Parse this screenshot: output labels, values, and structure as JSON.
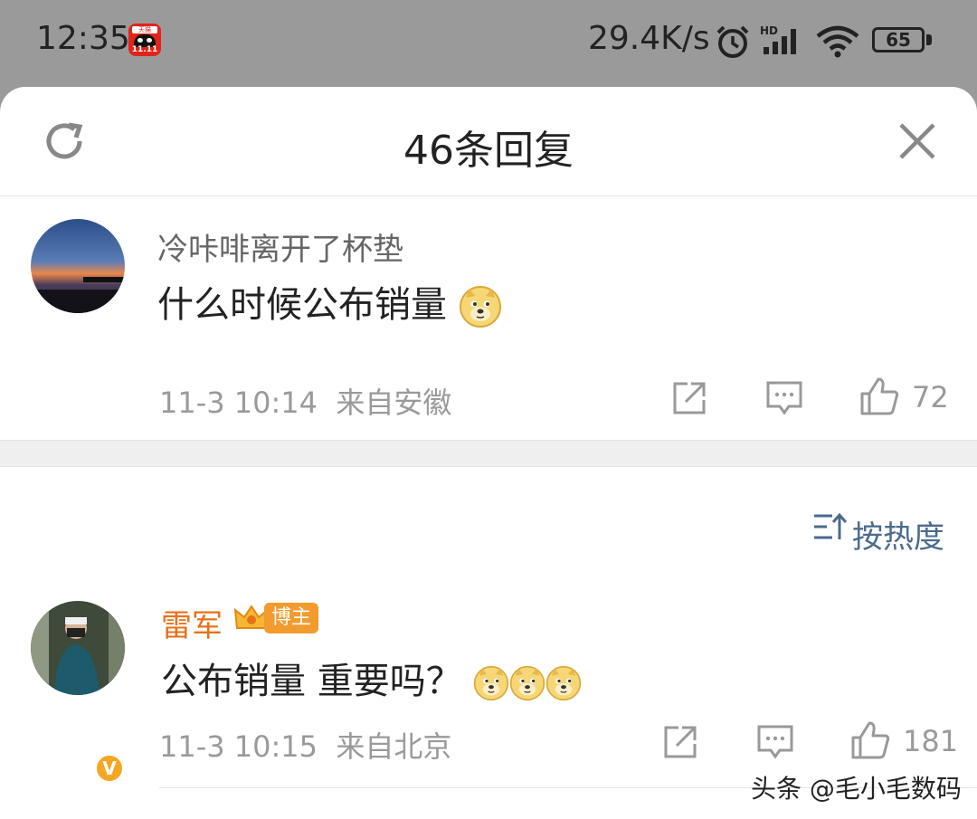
{
  "status_bar": {
    "time": "12:35",
    "network_speed": "29.4K/s",
    "signal_badge": "HD",
    "battery": "65",
    "app_badge_top": "天猫",
    "app_badge_bottom": "11.11"
  },
  "sheet": {
    "title": "46条回复",
    "icons": {
      "refresh": "refresh-icon",
      "close": "close-icon"
    }
  },
  "comments": [
    {
      "username": "冷咔啡离开了杯垫",
      "text": "什么时候公布销量",
      "emoji_count": 1,
      "time": "11-3 10:14",
      "source": "来自安徽",
      "likes": "72"
    },
    {
      "username": "雷军",
      "badge": "博主",
      "verified": "V",
      "text": "公布销量 重要吗？",
      "emoji_count": 3,
      "time": "11-3 10:15",
      "source": "来自北京",
      "likes": "181"
    }
  ],
  "sort": {
    "label": "按热度"
  },
  "watermark": "头条 @毛小毛数码",
  "colors": {
    "username_default": "#666666",
    "username_vip": "#e8701a",
    "sort_link": "#4b6a8c"
  }
}
